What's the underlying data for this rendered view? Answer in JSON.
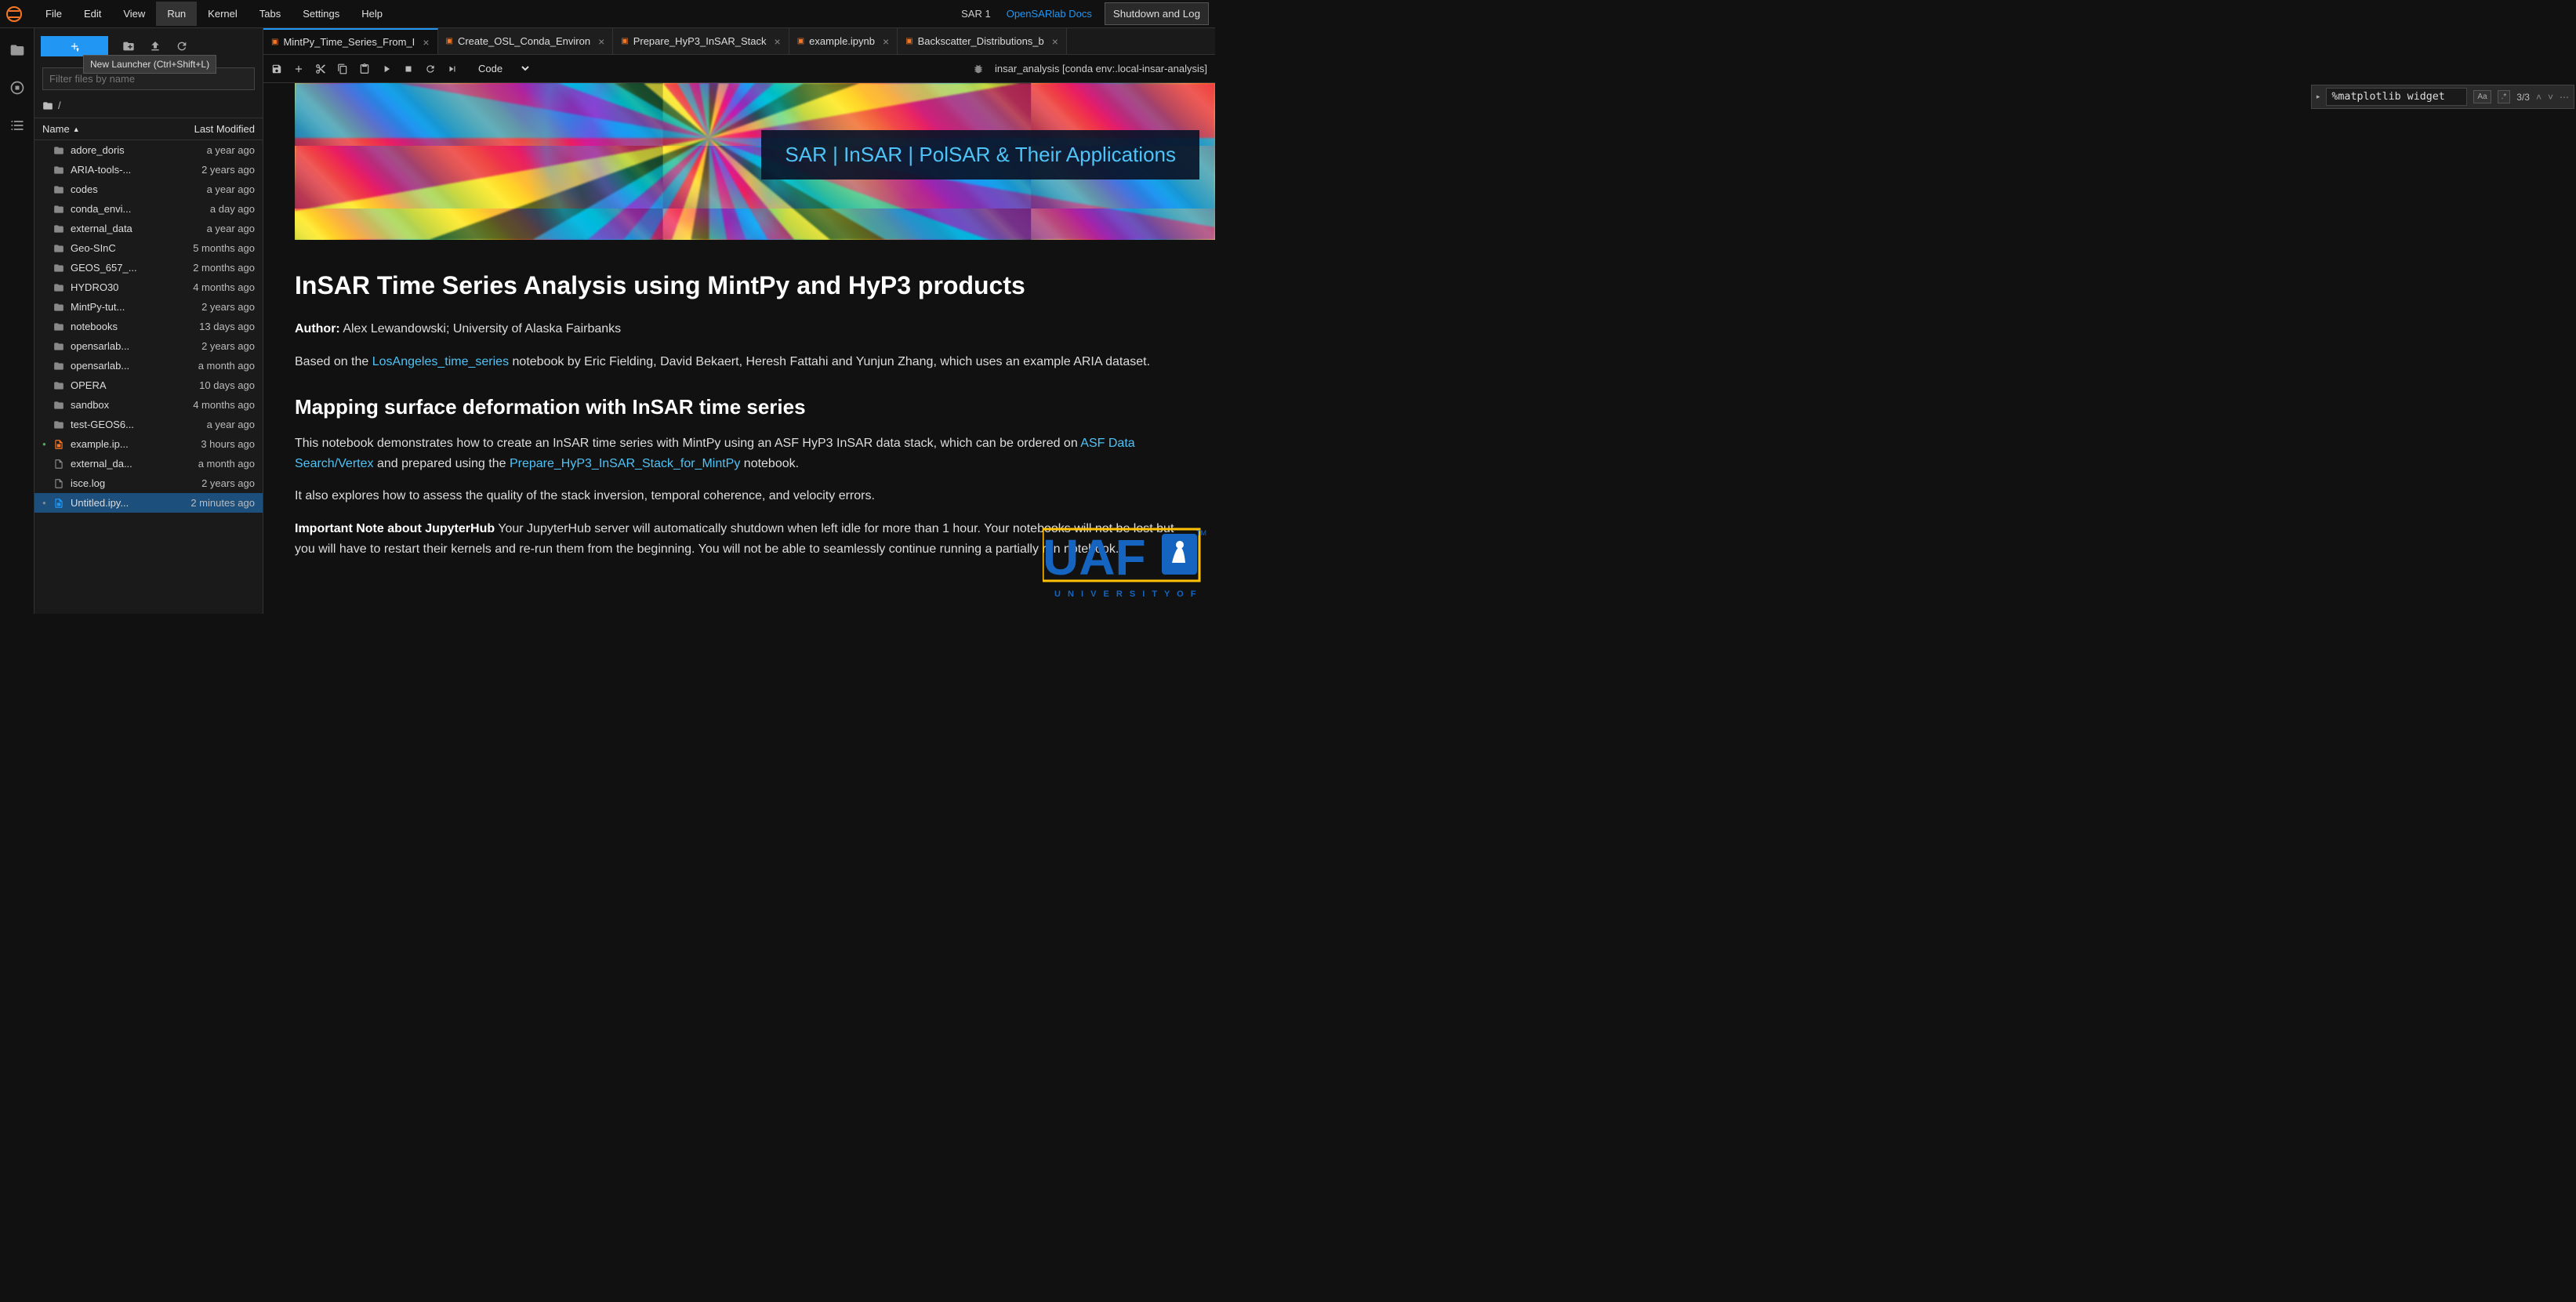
{
  "menu": {
    "items": [
      "File",
      "Edit",
      "View",
      "Run",
      "Kernel",
      "Tabs",
      "Settings",
      "Help"
    ],
    "active_index": 3,
    "sar_label": "SAR 1",
    "docs_link": "OpenSARlab Docs",
    "shutdown": "Shutdown and Log"
  },
  "tooltip": "New Launcher (Ctrl+Shift+L)",
  "filter_placeholder": "Filter files by name",
  "breadcrumb_root": "/",
  "fb_headers": {
    "name": "Name",
    "modified": "Last Modified"
  },
  "files": [
    {
      "type": "dir",
      "name": "adore_doris",
      "mod": "a year ago",
      "dot": ""
    },
    {
      "type": "dir",
      "name": "ARIA-tools-...",
      "mod": "2 years ago",
      "dot": ""
    },
    {
      "type": "dir",
      "name": "codes",
      "mod": "a year ago",
      "dot": ""
    },
    {
      "type": "dir",
      "name": "conda_envi...",
      "mod": "a day ago",
      "dot": ""
    },
    {
      "type": "dir",
      "name": "external_data",
      "mod": "a year ago",
      "dot": ""
    },
    {
      "type": "dir",
      "name": "Geo-SInC",
      "mod": "5 months ago",
      "dot": ""
    },
    {
      "type": "dir",
      "name": "GEOS_657_...",
      "mod": "2 months ago",
      "dot": ""
    },
    {
      "type": "dir",
      "name": "HYDRO30",
      "mod": "4 months ago",
      "dot": ""
    },
    {
      "type": "dir",
      "name": "MintPy-tut...",
      "mod": "2 years ago",
      "dot": ""
    },
    {
      "type": "dir",
      "name": "notebooks",
      "mod": "13 days ago",
      "dot": ""
    },
    {
      "type": "dir",
      "name": "opensarlab...",
      "mod": "2 years ago",
      "dot": ""
    },
    {
      "type": "dir",
      "name": "opensarlab...",
      "mod": "a month ago",
      "dot": ""
    },
    {
      "type": "dir",
      "name": "OPERA",
      "mod": "10 days ago",
      "dot": ""
    },
    {
      "type": "dir",
      "name": "sandbox",
      "mod": "4 months ago",
      "dot": ""
    },
    {
      "type": "dir",
      "name": "test-GEOS6...",
      "mod": "a year ago",
      "dot": ""
    },
    {
      "type": "nb",
      "name": "example.ip...",
      "mod": "3 hours ago",
      "dot": "running"
    },
    {
      "type": "file",
      "name": "external_da...",
      "mod": "a month ago",
      "dot": ""
    },
    {
      "type": "file",
      "name": "isce.log",
      "mod": "2 years ago",
      "dot": ""
    },
    {
      "type": "nb-sel",
      "name": "Untitled.ipy...",
      "mod": "2 minutes ago",
      "dot": "modified",
      "selected": true
    }
  ],
  "tabs": [
    {
      "label": "MintPy_Time_Series_From_I",
      "active": true
    },
    {
      "label": "Create_OSL_Conda_Environ",
      "active": false
    },
    {
      "label": "Prepare_HyP3_InSAR_Stack",
      "active": false
    },
    {
      "label": "example.ipynb",
      "active": false
    },
    {
      "label": "Backscatter_Distributions_b",
      "active": false
    }
  ],
  "cell_type": "Code",
  "kernel_name": "insar_analysis [conda env:.local-insar-analysis]",
  "find": {
    "value": "%matplotlib widget",
    "count": "3/3"
  },
  "banner_text": "SAR | InSAR | PolSAR & Their Applications",
  "content": {
    "h1": "InSAR Time Series Analysis using MintPy and HyP3 products",
    "author_label": "Author:",
    "author_value": " Alex Lewandowski; University of Alaska Fairbanks",
    "based_pre": "Based on the ",
    "based_link": "LosAngeles_time_series",
    "based_post": " notebook by Eric Fielding, David Bekaert, Heresh Fattahi and Yunjun Zhang, which uses an example ARIA dataset.",
    "h2": "Mapping surface deformation with InSAR time series",
    "p2_pre": "This notebook demonstrates how to create an InSAR time series with MintPy using an ASF HyP3 InSAR data stack, which can be ordered on ",
    "p2_link1": "ASF Data Search/Vertex",
    "p2_mid": " and prepared using the ",
    "p2_link2": "Prepare_HyP3_InSAR_Stack_for_MintPy",
    "p2_post": " notebook.",
    "p3": "It also explores how to assess the quality of the stack inversion, temporal coherence, and velocity errors.",
    "p4_bold": "Important Note about JupyterHub",
    "p4_rest": " Your JupyterHub server will automatically shutdown when left idle for more than 1 hour. Your notebooks will not be lost but you will have to restart their kernels and re-run them from the beginning. You will not be able to seamlessly continue running a partially run notebook.",
    "uaf_sub": "U N I V E R S I T Y   O F"
  }
}
